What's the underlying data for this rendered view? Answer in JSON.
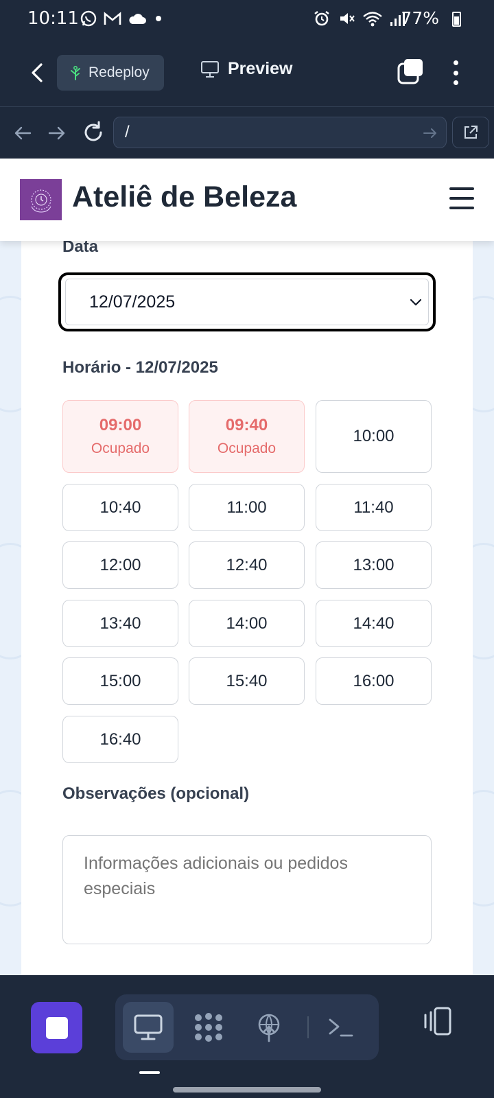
{
  "status_bar": {
    "time": "10:11",
    "battery": "77%",
    "left_icons": [
      "whatsapp-icon",
      "gmail-icon",
      "cloud-icon",
      "dot-icon"
    ],
    "right_icons": [
      "alarm-icon",
      "mute-icon",
      "wifi-icon",
      "signal-icon",
      "battery-icon"
    ]
  },
  "app_bar": {
    "redeploy_label": "Redeploy",
    "preview_label": "Preview"
  },
  "url_bar": {
    "value": "/"
  },
  "site": {
    "title": "Ateliê de Beleza"
  },
  "form": {
    "date_label": "Data",
    "date_value": "12/07/2025",
    "time_label": "Horário - 12/07/2025",
    "busy_status": "Ocupado",
    "slots": [
      {
        "time": "09:00",
        "busy": true
      },
      {
        "time": "09:40",
        "busy": true
      },
      {
        "time": "10:00",
        "busy": false
      },
      {
        "time": "10:40",
        "busy": false
      },
      {
        "time": "11:00",
        "busy": false
      },
      {
        "time": "11:40",
        "busy": false
      },
      {
        "time": "12:00",
        "busy": false
      },
      {
        "time": "12:40",
        "busy": false
      },
      {
        "time": "13:00",
        "busy": false
      },
      {
        "time": "13:40",
        "busy": false
      },
      {
        "time": "14:00",
        "busy": false
      },
      {
        "time": "14:40",
        "busy": false
      },
      {
        "time": "15:00",
        "busy": false
      },
      {
        "time": "15:40",
        "busy": false
      },
      {
        "time": "16:00",
        "busy": false
      },
      {
        "time": "16:40",
        "busy": false
      }
    ],
    "notes_label": "Observações (opcional)",
    "notes_placeholder": "Informações adicionais ou pedidos especiais"
  },
  "colors": {
    "chrome_bg": "#1e293b",
    "accent_purple": "#5b3fd9",
    "logo_purple": "#7b3f98",
    "busy_bg": "#fef2f2",
    "busy_text": "#e56b6b"
  }
}
